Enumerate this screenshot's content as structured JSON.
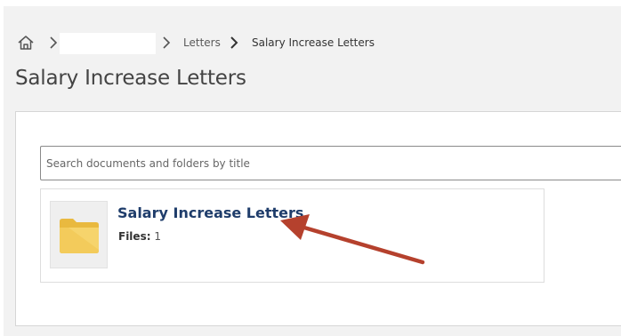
{
  "breadcrumb": {
    "items": [
      {
        "label": "Letters"
      },
      {
        "label": "Salary Increase Letters"
      }
    ]
  },
  "page": {
    "title": "Salary Increase Letters"
  },
  "search": {
    "placeholder": "Search documents and folders by title",
    "value": ""
  },
  "folders": [
    {
      "name": "Salary Increase Letters",
      "files_label": "Files:",
      "files_count": "1",
      "icon": "folder-icon"
    }
  ],
  "annotation": {
    "icon": "red-arrow-icon",
    "color": "#b5412d"
  },
  "colors": {
    "folder_title": "#1f3d6b",
    "folder_icon": "#f0c752",
    "background": "#f2f2f2"
  }
}
